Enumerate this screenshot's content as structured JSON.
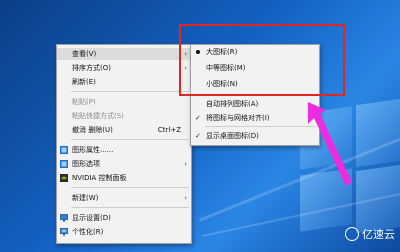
{
  "context_menu": {
    "items": [
      {
        "label": "查看(V)",
        "arrow": "›"
      },
      {
        "label": "排序方式(O)",
        "arrow": "›"
      },
      {
        "label": "刷新(E)"
      },
      {
        "label": "粘贴(P)"
      },
      {
        "label": "粘贴快捷方式(S)"
      },
      {
        "label": "撤消 删除(U)",
        "shortcut": "Ctrl+Z"
      },
      {
        "label": "图形属性......"
      },
      {
        "label": "图形选项",
        "arrow": "›"
      },
      {
        "label": "NVIDIA 控制面板"
      },
      {
        "label": "新建(W)",
        "arrow": "›"
      },
      {
        "label": "显示设置(D)"
      },
      {
        "label": "个性化(R)"
      }
    ]
  },
  "view_submenu": {
    "items": [
      {
        "label": "大图标(R)",
        "bullet": true
      },
      {
        "label": "中等图标(M)"
      },
      {
        "label": "小图标(N)"
      },
      {
        "label": "自动排列图标(A)"
      },
      {
        "label": "将图标与网格对齐(I)",
        "check": "✓"
      },
      {
        "label": "显示桌面图标(D)",
        "check": "✓"
      }
    ]
  },
  "annotation": {
    "color": "#e0261f",
    "arrow_color": "#ee2be0"
  },
  "watermark": {
    "text": "亿速云"
  }
}
